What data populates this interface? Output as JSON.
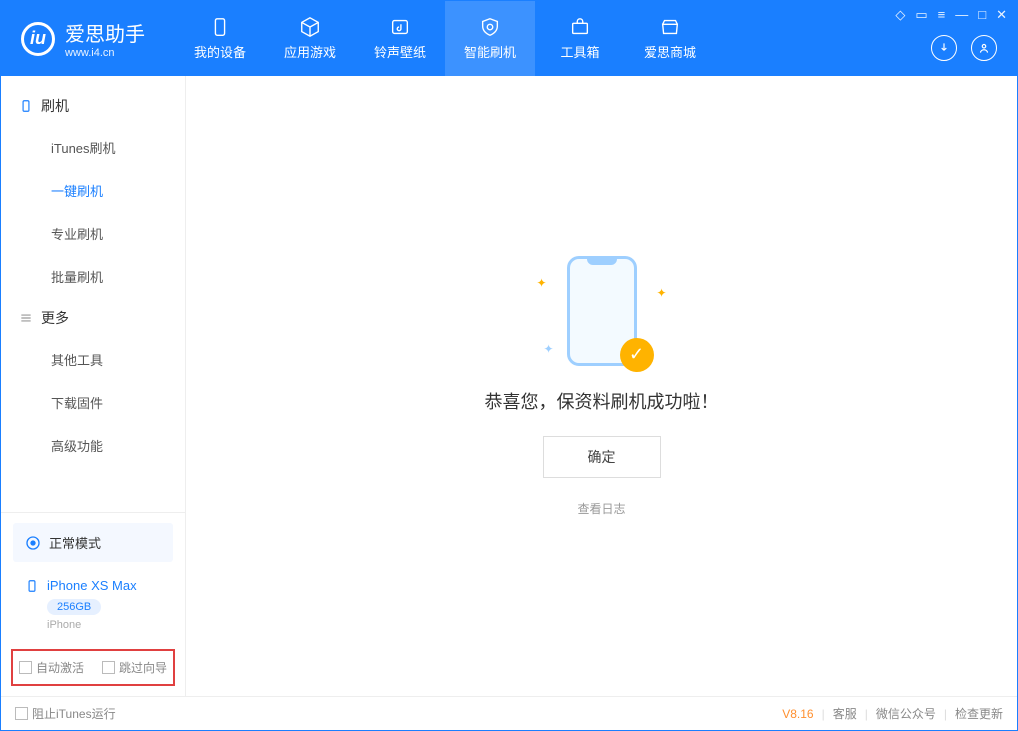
{
  "app": {
    "name": "爱思助手",
    "site": "www.i4.cn"
  },
  "nav": {
    "items": [
      {
        "label": "我的设备"
      },
      {
        "label": "应用游戏"
      },
      {
        "label": "铃声壁纸"
      },
      {
        "label": "智能刷机"
      },
      {
        "label": "工具箱"
      },
      {
        "label": "爱思商城"
      }
    ]
  },
  "sidebar": {
    "group1": {
      "title": "刷机",
      "items": [
        "iTunes刷机",
        "一键刷机",
        "专业刷机",
        "批量刷机"
      ]
    },
    "group2": {
      "title": "更多",
      "items": [
        "其他工具",
        "下载固件",
        "高级功能"
      ]
    },
    "mode": "正常模式",
    "device": {
      "name": "iPhone XS Max",
      "capacity": "256GB",
      "type": "iPhone"
    },
    "opts": {
      "auto_activate": "自动激活",
      "skip_guide": "跳过向导"
    }
  },
  "main": {
    "success_msg": "恭喜您，保资料刷机成功啦！",
    "ok": "确定",
    "view_log": "查看日志"
  },
  "footer": {
    "block_itunes": "阻止iTunes运行",
    "version": "V8.16",
    "links": [
      "客服",
      "微信公众号",
      "检查更新"
    ]
  }
}
